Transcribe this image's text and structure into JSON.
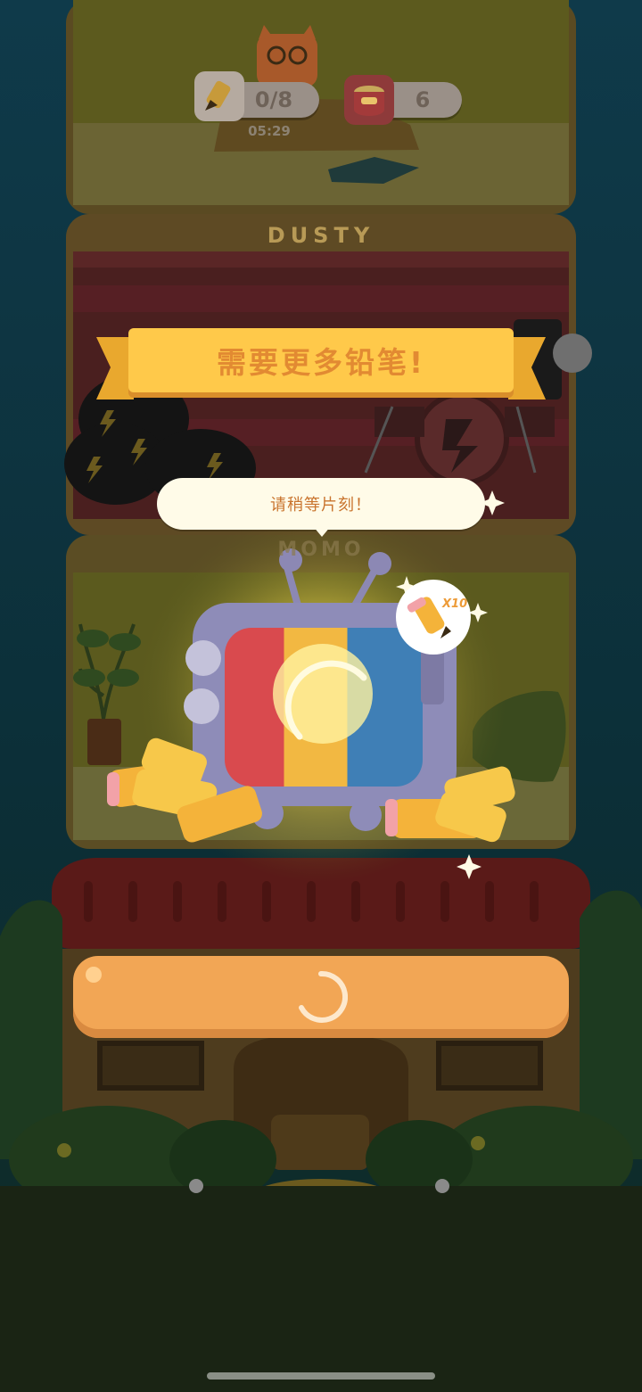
{
  "hud": {
    "pencil_progress": "0/8",
    "can_count": "6",
    "timer": "05:29"
  },
  "floors": {
    "upper_name": "DUSTY",
    "lower_name": "MOMO"
  },
  "popup": {
    "title": "需要更多铅笔!",
    "bubble": "请稍等片刻！",
    "reward_label": "X10",
    "button_state": "loading"
  },
  "colors": {
    "ribbon": "#ffc94a",
    "button": "#f2a655",
    "bubble": "#fffbe8"
  },
  "icons": [
    "pencil-icon",
    "cat-food-can-icon",
    "tv-prize-icon",
    "loading-spinner-icon",
    "sparkle-icon"
  ]
}
